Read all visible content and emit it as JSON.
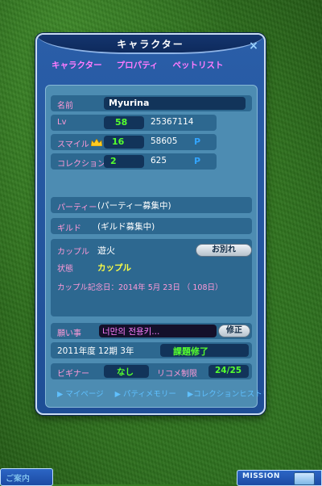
{
  "window": {
    "title": "キャラクター",
    "close_icon": "close-icon"
  },
  "tabs": [
    "キャラクター",
    "プロパティ",
    "ペットリスト"
  ],
  "profile": {
    "name_label": "名前",
    "name_value": "Myurina",
    "lv_label": "Lv",
    "lv_value": "58",
    "lv_exp": "25367114",
    "smile_label": "スマイル",
    "smile_value": "16",
    "smile_points": "58605",
    "smile_unit": "P",
    "collection_label": "コレクション",
    "collection_value": "2",
    "collection_points": "625",
    "collection_unit": "P"
  },
  "party": {
    "label": "パーティー",
    "value": "(パーティー募集中)"
  },
  "guild": {
    "label": "ギルド",
    "value": "(ギルド募集中)"
  },
  "couple": {
    "couple_label": "カップル",
    "partner": "遊火",
    "breakup_button": "お別れ",
    "status_label": "状態",
    "status_value": "カップル",
    "anniversary": "カップル記念日：2014年 5月 23日 （ 108日）"
  },
  "wish": {
    "label": "願い事",
    "value": "너만의 전용키...",
    "edit_button": "修正"
  },
  "school": {
    "year": "2011年度 12期 3年",
    "status": "課題修了"
  },
  "beginner": {
    "label": "ビギナー",
    "value": "なし"
  },
  "comment_limit": {
    "label": "リコメ制限",
    "value": "24/25"
  },
  "links": [
    "▶ マイページ",
    "▶ パティメモリー",
    "▶コレクションヒストリー"
  ],
  "hud": {
    "guide_button": "ご案内",
    "mission_button": "MISSION"
  },
  "colors": {
    "accent_pink": "#ff7bff",
    "value_green": "#55ff2e",
    "point_blue": "#33a4ff"
  }
}
